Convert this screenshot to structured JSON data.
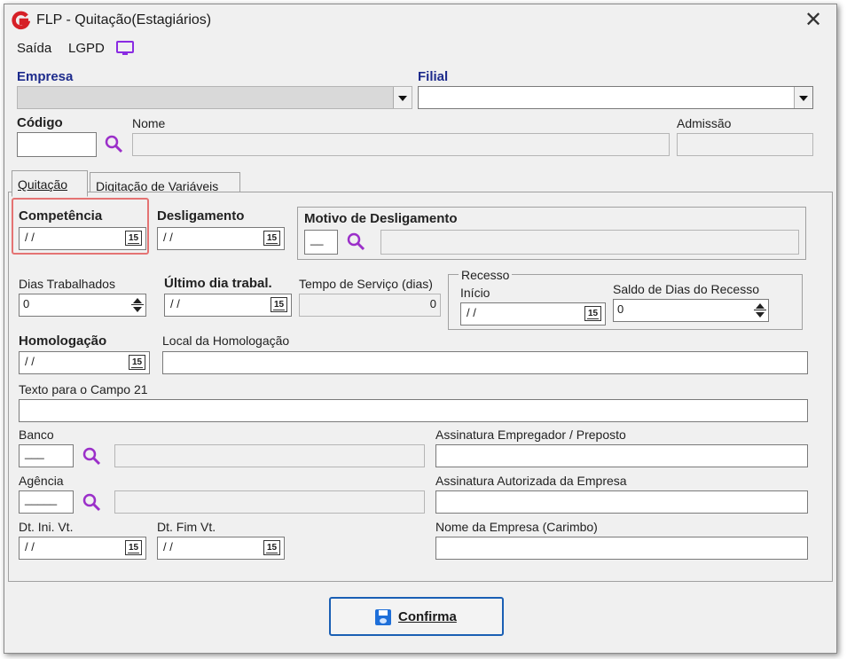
{
  "window": {
    "title": "FLP - Quitação(Estagiários)",
    "close": "✕"
  },
  "menu": {
    "saida": "Saída",
    "lgpd": "LGPD"
  },
  "header": {
    "empresa_label": "Empresa",
    "filial_label": "Filial",
    "codigo_label": "Código",
    "nome_label": "Nome",
    "admissao_label": "Admissão"
  },
  "tabs": [
    {
      "label": "Quitação",
      "active": true
    },
    {
      "label": "Digitação de Variáveis",
      "active": false
    }
  ],
  "form": {
    "competencia_label": "Competência",
    "competencia_value": "/ /",
    "desligamento_label": "Desligamento",
    "desligamento_value": "/ /",
    "motivo_label": "Motivo de Desligamento",
    "motivo_code": "__",
    "dias_trab_label": "Dias Trabalhados",
    "dias_trab_value": "0",
    "ultimo_dia_label": "Último dia trabal.",
    "ultimo_dia_value": "/ /",
    "tempo_servico_label": "Tempo de Serviço (dias)",
    "tempo_servico_value": "0",
    "recesso_label": "Recesso",
    "inicio_label": "Início",
    "inicio_value": "/ /",
    "saldo_label": "Saldo de Dias do Recesso",
    "saldo_value": "0",
    "homologacao_label": "Homologação",
    "homologacao_value": "/ /",
    "local_homol_label": "Local da Homologação",
    "texto21_label": "Texto para o Campo 21",
    "banco_label": "Banco",
    "banco_value": "___",
    "assin_empregador_label": "Assinatura Empregador / Preposto",
    "agencia_label": "Agência",
    "agencia_value": "_____",
    "assin_autorizada_label": "Assinatura Autorizada da Empresa",
    "dt_ini_label": "Dt. Ini. Vt.",
    "dt_ini_value": "/ /",
    "dt_fim_label": "Dt. Fim Vt.",
    "dt_fim_value": "/ /",
    "nome_empresa_label": "Nome da Empresa (Carimbo)",
    "calendar_glyph": "15"
  },
  "buttons": {
    "confirma": "Confirma"
  },
  "colors": {
    "accent": "#1d2b8c",
    "highlight": "#e47373",
    "search_icon": "#9b2fc9",
    "lgpd_icon": "#8a2be2"
  }
}
